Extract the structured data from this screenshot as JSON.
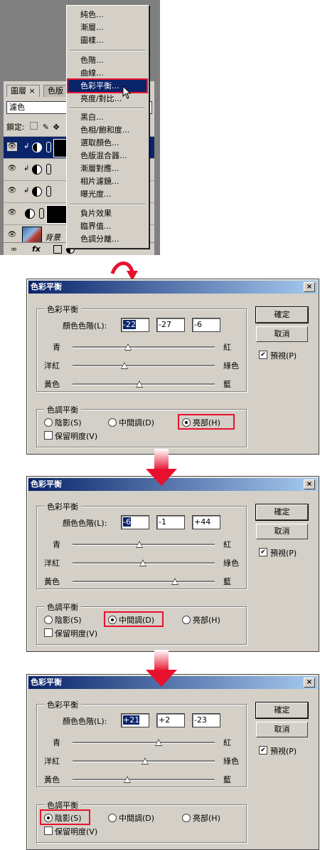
{
  "layers_panel": {
    "tabs": [
      "圖層",
      "色版"
    ],
    "tab_close": "×",
    "blend_mode": "濾色",
    "lock_label": "鎖定:",
    "background_layer_name": "背景"
  },
  "adjust_menu": {
    "items": [
      "純色...",
      "漸層...",
      "圖樣...",
      "色階...",
      "曲線...",
      "色彩平衡...",
      "亮度/對比...",
      "黑白...",
      "色相/飽和度...",
      "選取顏色...",
      "色版混合器...",
      "漸層對應...",
      "相片濾鏡...",
      "曝光度...",
      "負片效果",
      "臨界值...",
      "色調分離..."
    ],
    "highlighted": "色彩平衡..."
  },
  "dialog_common": {
    "title": "色彩平衡",
    "close": "×",
    "group_color": "色彩平衡",
    "levels_label": "顏色色階(L):",
    "cyan": "青",
    "red": "紅",
    "magenta": "洋紅",
    "green": "綠色",
    "yellow": "黃色",
    "blue": "藍",
    "group_tone": "色調平衡",
    "shadows": "陰影(S)",
    "midtones": "中間調(D)",
    "highlights": "亮部(H)",
    "preserve": "保留明度(V)",
    "ok": "確定",
    "cancel": "取消",
    "preview": "預視(P)"
  },
  "dialogs": [
    {
      "values": [
        "-22",
        "-27",
        "-6"
      ],
      "tone_selected": "highlights",
      "slider_levels": [
        -22,
        -27,
        -6
      ]
    },
    {
      "values": [
        "-6",
        "-1",
        "+44"
      ],
      "tone_selected": "midtones",
      "slider_levels": [
        -6,
        -1,
        44
      ]
    },
    {
      "values": [
        "+21",
        "+2",
        "-23"
      ],
      "tone_selected": "shadows",
      "slider_levels": [
        21,
        2,
        -23
      ]
    }
  ],
  "colors": {
    "highlight": "#0a246a",
    "annotation_red": "#e8112d",
    "dialog_bg": "#d4d0c8"
  }
}
